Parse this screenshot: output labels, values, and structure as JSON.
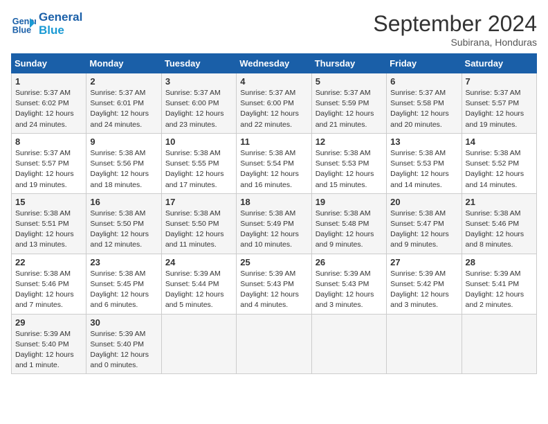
{
  "logo": {
    "line1": "General",
    "line2": "Blue"
  },
  "title": "September 2024",
  "subtitle": "Subirana, Honduras",
  "days_header": [
    "Sunday",
    "Monday",
    "Tuesday",
    "Wednesday",
    "Thursday",
    "Friday",
    "Saturday"
  ],
  "weeks": [
    [
      {
        "day": "1",
        "sunrise": "5:37 AM",
        "sunset": "6:02 PM",
        "daylight": "12 hours and 24 minutes."
      },
      {
        "day": "2",
        "sunrise": "5:37 AM",
        "sunset": "6:01 PM",
        "daylight": "12 hours and 24 minutes."
      },
      {
        "day": "3",
        "sunrise": "5:37 AM",
        "sunset": "6:00 PM",
        "daylight": "12 hours and 23 minutes."
      },
      {
        "day": "4",
        "sunrise": "5:37 AM",
        "sunset": "6:00 PM",
        "daylight": "12 hours and 22 minutes."
      },
      {
        "day": "5",
        "sunrise": "5:37 AM",
        "sunset": "5:59 PM",
        "daylight": "12 hours and 21 minutes."
      },
      {
        "day": "6",
        "sunrise": "5:37 AM",
        "sunset": "5:58 PM",
        "daylight": "12 hours and 20 minutes."
      },
      {
        "day": "7",
        "sunrise": "5:37 AM",
        "sunset": "5:57 PM",
        "daylight": "12 hours and 19 minutes."
      }
    ],
    [
      {
        "day": "8",
        "sunrise": "5:37 AM",
        "sunset": "5:57 PM",
        "daylight": "12 hours and 19 minutes."
      },
      {
        "day": "9",
        "sunrise": "5:38 AM",
        "sunset": "5:56 PM",
        "daylight": "12 hours and 18 minutes."
      },
      {
        "day": "10",
        "sunrise": "5:38 AM",
        "sunset": "5:55 PM",
        "daylight": "12 hours and 17 minutes."
      },
      {
        "day": "11",
        "sunrise": "5:38 AM",
        "sunset": "5:54 PM",
        "daylight": "12 hours and 16 minutes."
      },
      {
        "day": "12",
        "sunrise": "5:38 AM",
        "sunset": "5:53 PM",
        "daylight": "12 hours and 15 minutes."
      },
      {
        "day": "13",
        "sunrise": "5:38 AM",
        "sunset": "5:53 PM",
        "daylight": "12 hours and 14 minutes."
      },
      {
        "day": "14",
        "sunrise": "5:38 AM",
        "sunset": "5:52 PM",
        "daylight": "12 hours and 14 minutes."
      }
    ],
    [
      {
        "day": "15",
        "sunrise": "5:38 AM",
        "sunset": "5:51 PM",
        "daylight": "12 hours and 13 minutes."
      },
      {
        "day": "16",
        "sunrise": "5:38 AM",
        "sunset": "5:50 PM",
        "daylight": "12 hours and 12 minutes."
      },
      {
        "day": "17",
        "sunrise": "5:38 AM",
        "sunset": "5:50 PM",
        "daylight": "12 hours and 11 minutes."
      },
      {
        "day": "18",
        "sunrise": "5:38 AM",
        "sunset": "5:49 PM",
        "daylight": "12 hours and 10 minutes."
      },
      {
        "day": "19",
        "sunrise": "5:38 AM",
        "sunset": "5:48 PM",
        "daylight": "12 hours and 9 minutes."
      },
      {
        "day": "20",
        "sunrise": "5:38 AM",
        "sunset": "5:47 PM",
        "daylight": "12 hours and 9 minutes."
      },
      {
        "day": "21",
        "sunrise": "5:38 AM",
        "sunset": "5:46 PM",
        "daylight": "12 hours and 8 minutes."
      }
    ],
    [
      {
        "day": "22",
        "sunrise": "5:38 AM",
        "sunset": "5:46 PM",
        "daylight": "12 hours and 7 minutes."
      },
      {
        "day": "23",
        "sunrise": "5:38 AM",
        "sunset": "5:45 PM",
        "daylight": "12 hours and 6 minutes."
      },
      {
        "day": "24",
        "sunrise": "5:39 AM",
        "sunset": "5:44 PM",
        "daylight": "12 hours and 5 minutes."
      },
      {
        "day": "25",
        "sunrise": "5:39 AM",
        "sunset": "5:43 PM",
        "daylight": "12 hours and 4 minutes."
      },
      {
        "day": "26",
        "sunrise": "5:39 AM",
        "sunset": "5:43 PM",
        "daylight": "12 hours and 3 minutes."
      },
      {
        "day": "27",
        "sunrise": "5:39 AM",
        "sunset": "5:42 PM",
        "daylight": "12 hours and 3 minutes."
      },
      {
        "day": "28",
        "sunrise": "5:39 AM",
        "sunset": "5:41 PM",
        "daylight": "12 hours and 2 minutes."
      }
    ],
    [
      {
        "day": "29",
        "sunrise": "5:39 AM",
        "sunset": "5:40 PM",
        "daylight": "12 hours and 1 minute."
      },
      {
        "day": "30",
        "sunrise": "5:39 AM",
        "sunset": "5:40 PM",
        "daylight": "12 hours and 0 minutes."
      },
      null,
      null,
      null,
      null,
      null
    ]
  ]
}
